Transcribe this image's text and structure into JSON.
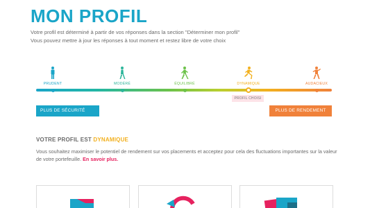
{
  "header": {
    "title": "MON PROFIL",
    "intro_line1": "Votre profil est déterminé à partir de vos réponses dans la section \"Déterminer mon profil\"",
    "intro_line2": "Vous pouvez mettre à jour les réponses à tout moment et restez libre de votre choix"
  },
  "profiles": [
    {
      "label": "PRUDENT",
      "color": "#1aa5c8",
      "icon": "standing-person-icon"
    },
    {
      "label": "MODÉRÉ",
      "color": "#2cb59a",
      "icon": "walking-person-icon"
    },
    {
      "label": "ÉQUILIBRÉ",
      "color": "#6cc24a",
      "icon": "walking-person-icon"
    },
    {
      "label": "DYNAMIQUE",
      "color": "#f2b01e",
      "icon": "running-person-icon"
    },
    {
      "label": "AUDACIEUX",
      "color": "#f0813a",
      "icon": "running-person-icon"
    }
  ],
  "selected_profile_index": 3,
  "chosen_label": "PROFIL CHOISI",
  "buttons": {
    "safety": "PLUS DE SÉCURITÉ",
    "yield": "PLUS DE RENDEMENT"
  },
  "profile_section": {
    "heading_prefix": "VOTRE PROFIL EST",
    "heading_value": "DYNAMIQUE",
    "description": "Vous souhaitez maximiser le potentiel de rendement sur vos placements et acceptez pour cela des fluctuations importantes sur la valeur de votre portefeuille.",
    "link_text": "En savoir plus."
  },
  "colors": {
    "accent_blue": "#1aa5c8",
    "accent_orange": "#f0813a",
    "accent_yellow": "#f2b01e",
    "accent_pink": "#e6225f"
  }
}
